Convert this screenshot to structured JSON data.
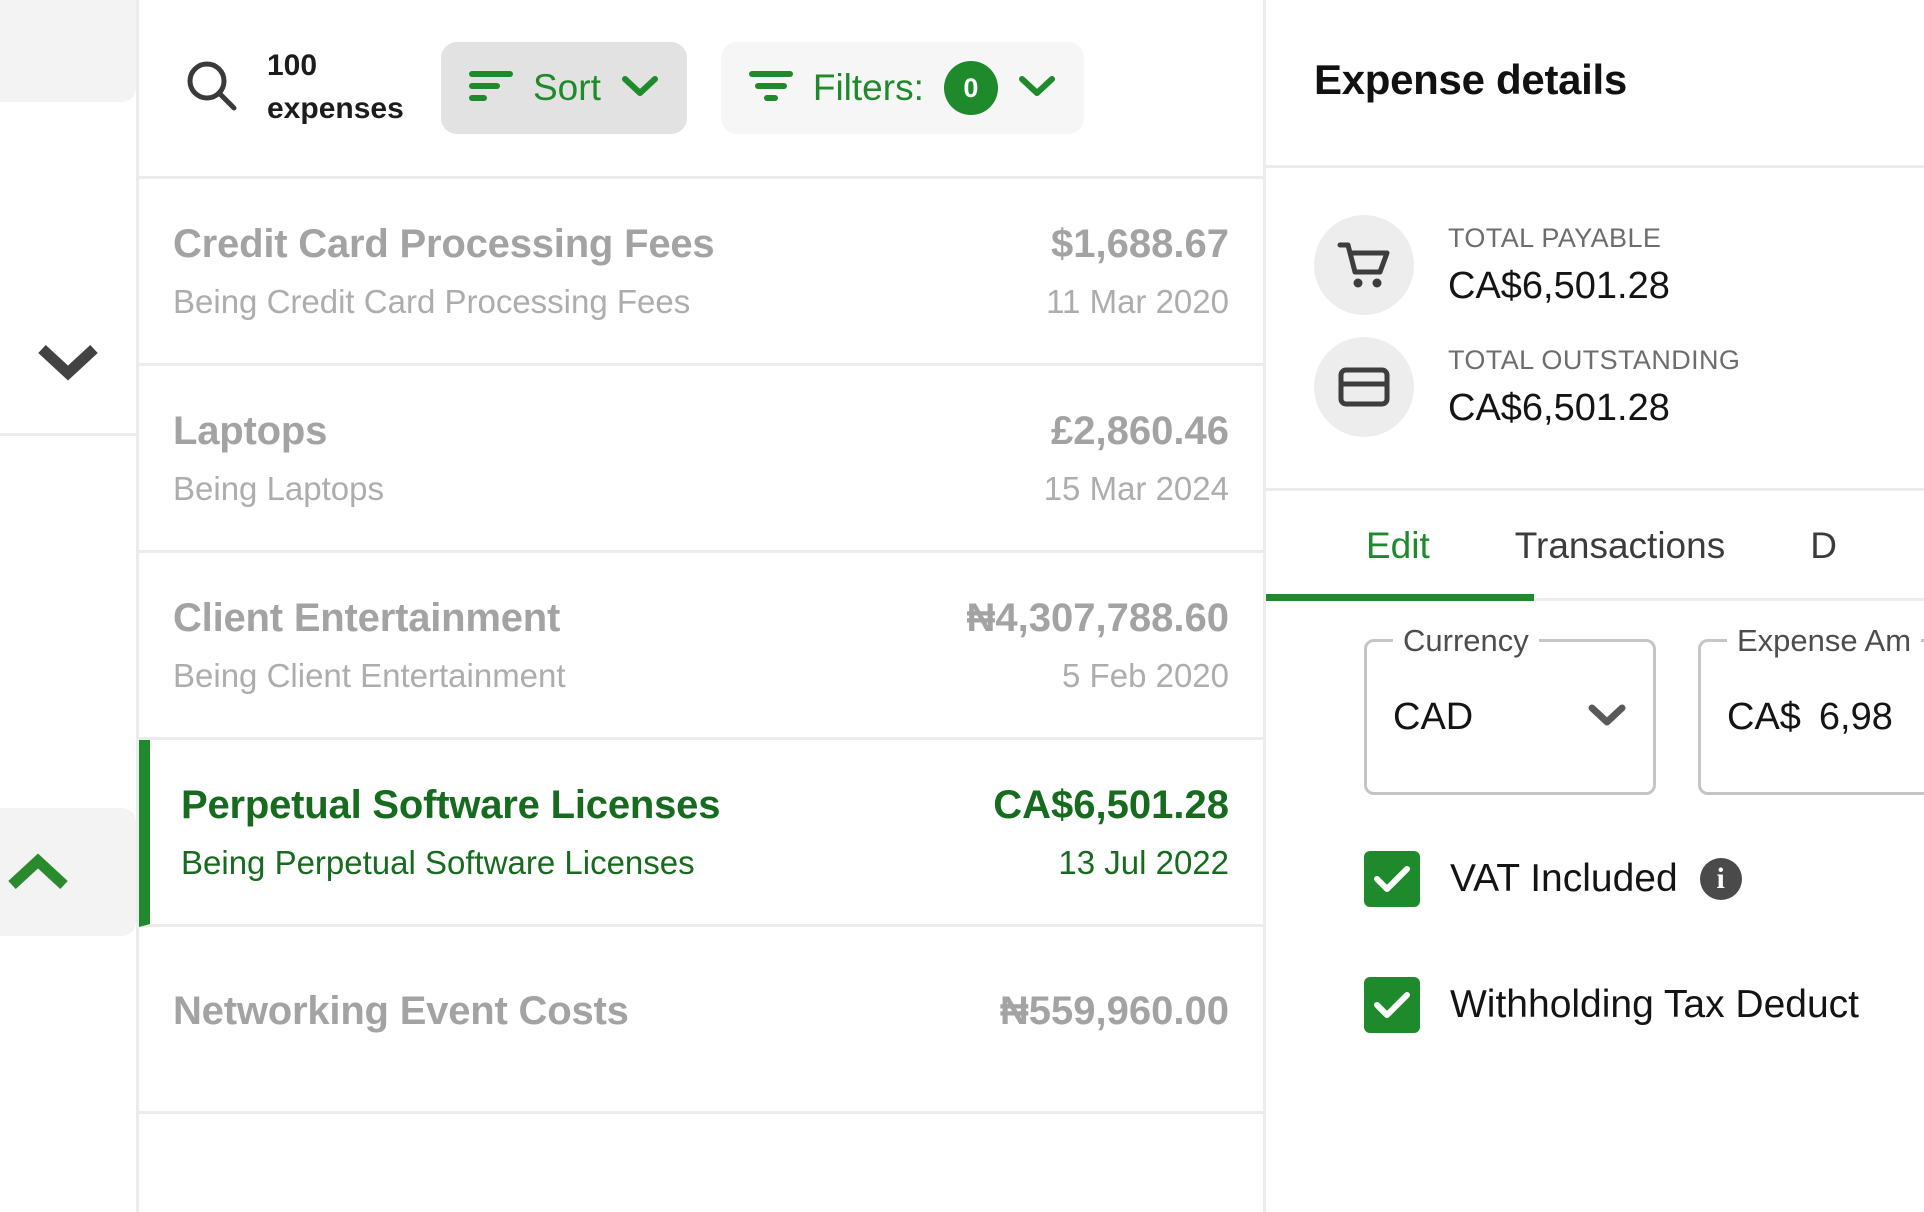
{
  "rail": {
    "chevron_down_icon": "chevron-down",
    "chevron_up_icon": "chevron-up"
  },
  "toolbar": {
    "search_icon": "search-icon",
    "count_number": "100",
    "count_word": "expenses",
    "sort_label": "Sort",
    "sort_icon": "sort-icon",
    "sort_chevron_icon": "chevron-down-icon",
    "filters_label": "Filters:",
    "filters_icon": "filter-icon",
    "filters_count": "0",
    "filters_chevron_icon": "chevron-down-icon"
  },
  "expenses": [
    {
      "title": "Credit Card Processing Fees",
      "amount": "$1,688.67",
      "description": "Being Credit Card Processing Fees",
      "date": "11 Mar 2020",
      "selected": false
    },
    {
      "title": "Laptops",
      "amount": "£2,860.46",
      "description": "Being Laptops",
      "date": "15 Mar 2024",
      "selected": false
    },
    {
      "title": "Client Entertainment",
      "amount": "₦4,307,788.60",
      "description": "Being Client Entertainment",
      "date": "5 Feb 2020",
      "selected": false
    },
    {
      "title": "Perpetual Software Licenses",
      "amount": "CA$6,501.28",
      "description": "Being Perpetual Software Licenses",
      "date": "13 Jul 2022",
      "selected": true
    },
    {
      "title": "Networking Event Costs",
      "amount": "₦559,960.00",
      "description": "",
      "date": "",
      "selected": false
    }
  ],
  "detail": {
    "title": "Expense details",
    "summary": [
      {
        "icon": "shopping-cart-icon",
        "label": "TOTAL PAYABLE",
        "value": "CA$6,501.28"
      },
      {
        "icon": "credit-card-icon",
        "label": "TOTAL OUTSTANDING",
        "value": "CA$6,501.28"
      }
    ],
    "tabs": [
      {
        "label": "Edit",
        "active": true
      },
      {
        "label": "Transactions",
        "active": false
      },
      {
        "label": "D",
        "active": false
      }
    ],
    "form": {
      "currency_legend": "Currency",
      "currency_value": "CAD",
      "currency_chevron_icon": "chevron-down-icon",
      "amount_legend": "Expense Am",
      "amount_currency": "CA$",
      "amount_value": "6,98",
      "vat_label": "VAT Included",
      "vat_checked": true,
      "vat_info_icon": "info-icon",
      "withholding_label": "Withholding Tax Deduct",
      "withholding_checked": true
    }
  },
  "colors": {
    "brand_green": "#1f8a2b",
    "selected_green": "#176b1f",
    "muted_gray": "#a3a3a3",
    "border_gray": "#ececec"
  }
}
